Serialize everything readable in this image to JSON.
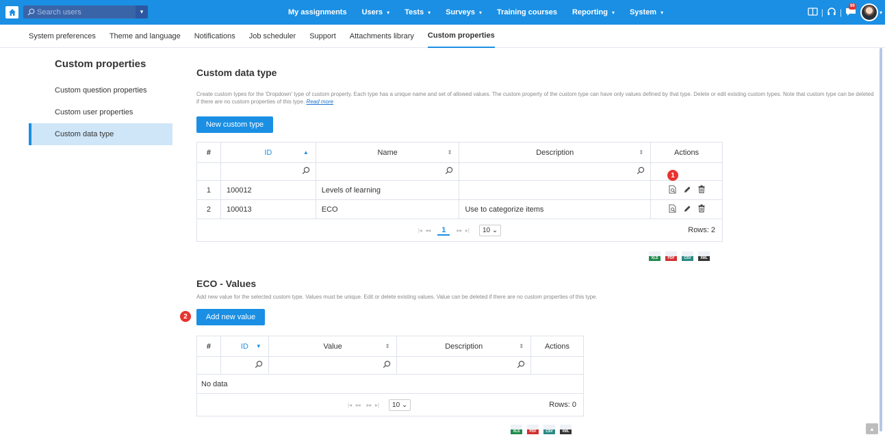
{
  "topnav": {
    "search_placeholder": "Search users",
    "items": [
      {
        "label": "My assignments",
        "caret": false
      },
      {
        "label": "Users",
        "caret": true
      },
      {
        "label": "Tests",
        "caret": true
      },
      {
        "label": "Surveys",
        "caret": true
      },
      {
        "label": "Training courses",
        "caret": false
      },
      {
        "label": "Reporting",
        "caret": true
      },
      {
        "label": "System",
        "caret": true
      }
    ],
    "notification_count": "99"
  },
  "subnav": {
    "tabs": [
      "System preferences",
      "Theme and language",
      "Notifications",
      "Job scheduler",
      "Support",
      "Attachments library",
      "Custom properties"
    ],
    "active_index": 6
  },
  "sidebar": {
    "title": "Custom properties",
    "items": [
      "Custom question properties",
      "Custom user properties",
      "Custom data type"
    ],
    "active_index": 2
  },
  "data_type": {
    "title": "Custom data type",
    "description": "Create custom types for the 'Dropdown' type of custom property. Each type has a unique name and set of allowed values. The custom property of the custom type can have only values defined by that type. Delete or edit existing custom types. Note that custom type can be deleted if there are no custom properties of this type.",
    "read_more": "Read more",
    "new_button": "New custom type",
    "columns": [
      "#",
      "ID",
      "Name",
      "Description",
      "Actions"
    ],
    "rows": [
      {
        "num": "1",
        "id": "100012",
        "name": "Levels of learning",
        "description": ""
      },
      {
        "num": "2",
        "id": "100013",
        "name": "ECO",
        "description": "Use to categorize items"
      }
    ],
    "page": "1",
    "page_size": "10",
    "rows_label": "Rows: 2"
  },
  "values_section": {
    "title": "ECO - Values",
    "description": "Add new value for the selected custom type. Values must be unique. Edit or delete existing values. Value can be deleted if there are no custom properties of this type.",
    "add_button": "Add new value",
    "columns": [
      "#",
      "ID",
      "Value",
      "Description",
      "Actions"
    ],
    "empty_text": "No data",
    "page_size": "10",
    "rows_label": "Rows: 0"
  },
  "exports": [
    "XLS",
    "PDF",
    "CSV",
    "XML"
  ],
  "markers": [
    "1",
    "2"
  ],
  "colors": {
    "primary": "#1a8fe3",
    "marker": "#e8332f",
    "active_bg": "#cfe6f8"
  }
}
